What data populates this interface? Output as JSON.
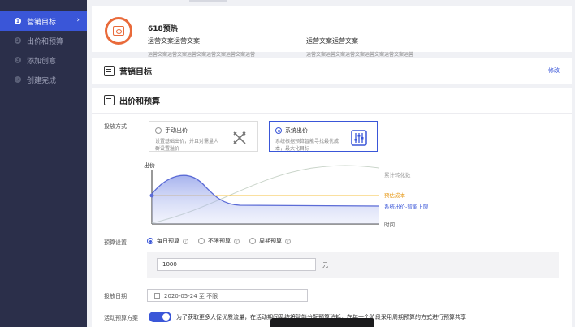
{
  "sidebar": {
    "steps": [
      {
        "num": "1",
        "label": "营销目标",
        "active": true
      },
      {
        "num": "2",
        "label": "出价和预算",
        "active": false
      },
      {
        "num": "3",
        "label": "添加创意",
        "active": false
      },
      {
        "num": "✓",
        "label": "创建完成",
        "active": false
      }
    ],
    "chevron": "›"
  },
  "promo": {
    "name": "618预热",
    "col1": {
      "heading": "运营文案运营文案",
      "sub": "运营文案运营文案运营文案运营文案运营文案运营"
    },
    "col2": {
      "heading": "运营文案运营文案",
      "sub": "运营文案运营文案运营文案运营文案运营文案运营"
    },
    "icon": "calendar-icon",
    "accent": "#e96a3a"
  },
  "goal": {
    "title": "营销目标",
    "edit_label": "修改"
  },
  "bidding": {
    "title": "出价和预算",
    "method_label": "投放方式",
    "options": [
      {
        "title": "手动出价",
        "desc": "设置基础出价，并且对需量人群设置溢价",
        "selected": false,
        "icon": "tools-icon"
      },
      {
        "title": "系统出价",
        "desc": "系统根据预算智能寻找最优成本，最大化目标",
        "selected": true,
        "icon": "sliders-icon"
      }
    ]
  },
  "chart_data": {
    "type": "line",
    "ylabel": "出价",
    "xlabel": "时间",
    "series": [
      {
        "name": "累计转化数",
        "color": "#c9d4c9"
      },
      {
        "name": "预估成本",
        "color": "#f5c040"
      },
      {
        "name": "系统出价-智能上限",
        "color": "#5b6bd6"
      }
    ]
  },
  "budget": {
    "label": "预算设置",
    "options": [
      {
        "label": "每日预算",
        "selected": true
      },
      {
        "label": "不限预算",
        "selected": false
      },
      {
        "label": "周期预算",
        "selected": false
      }
    ],
    "help": "?",
    "value": "1000",
    "unit": "元"
  },
  "schedule": {
    "label": "投放日期",
    "value": "2020-05-24 至 不限"
  },
  "activity": {
    "label": "活动预算方案",
    "text": "为了获取更多大促优质流量，在活动期间系统将智能分配预算消耗，在每一个阶段采用周期预算的方式进行预算共享",
    "enabled": true
  },
  "colors": {
    "accent": "#3a56d8",
    "sidebar": "#2b2f4a"
  }
}
